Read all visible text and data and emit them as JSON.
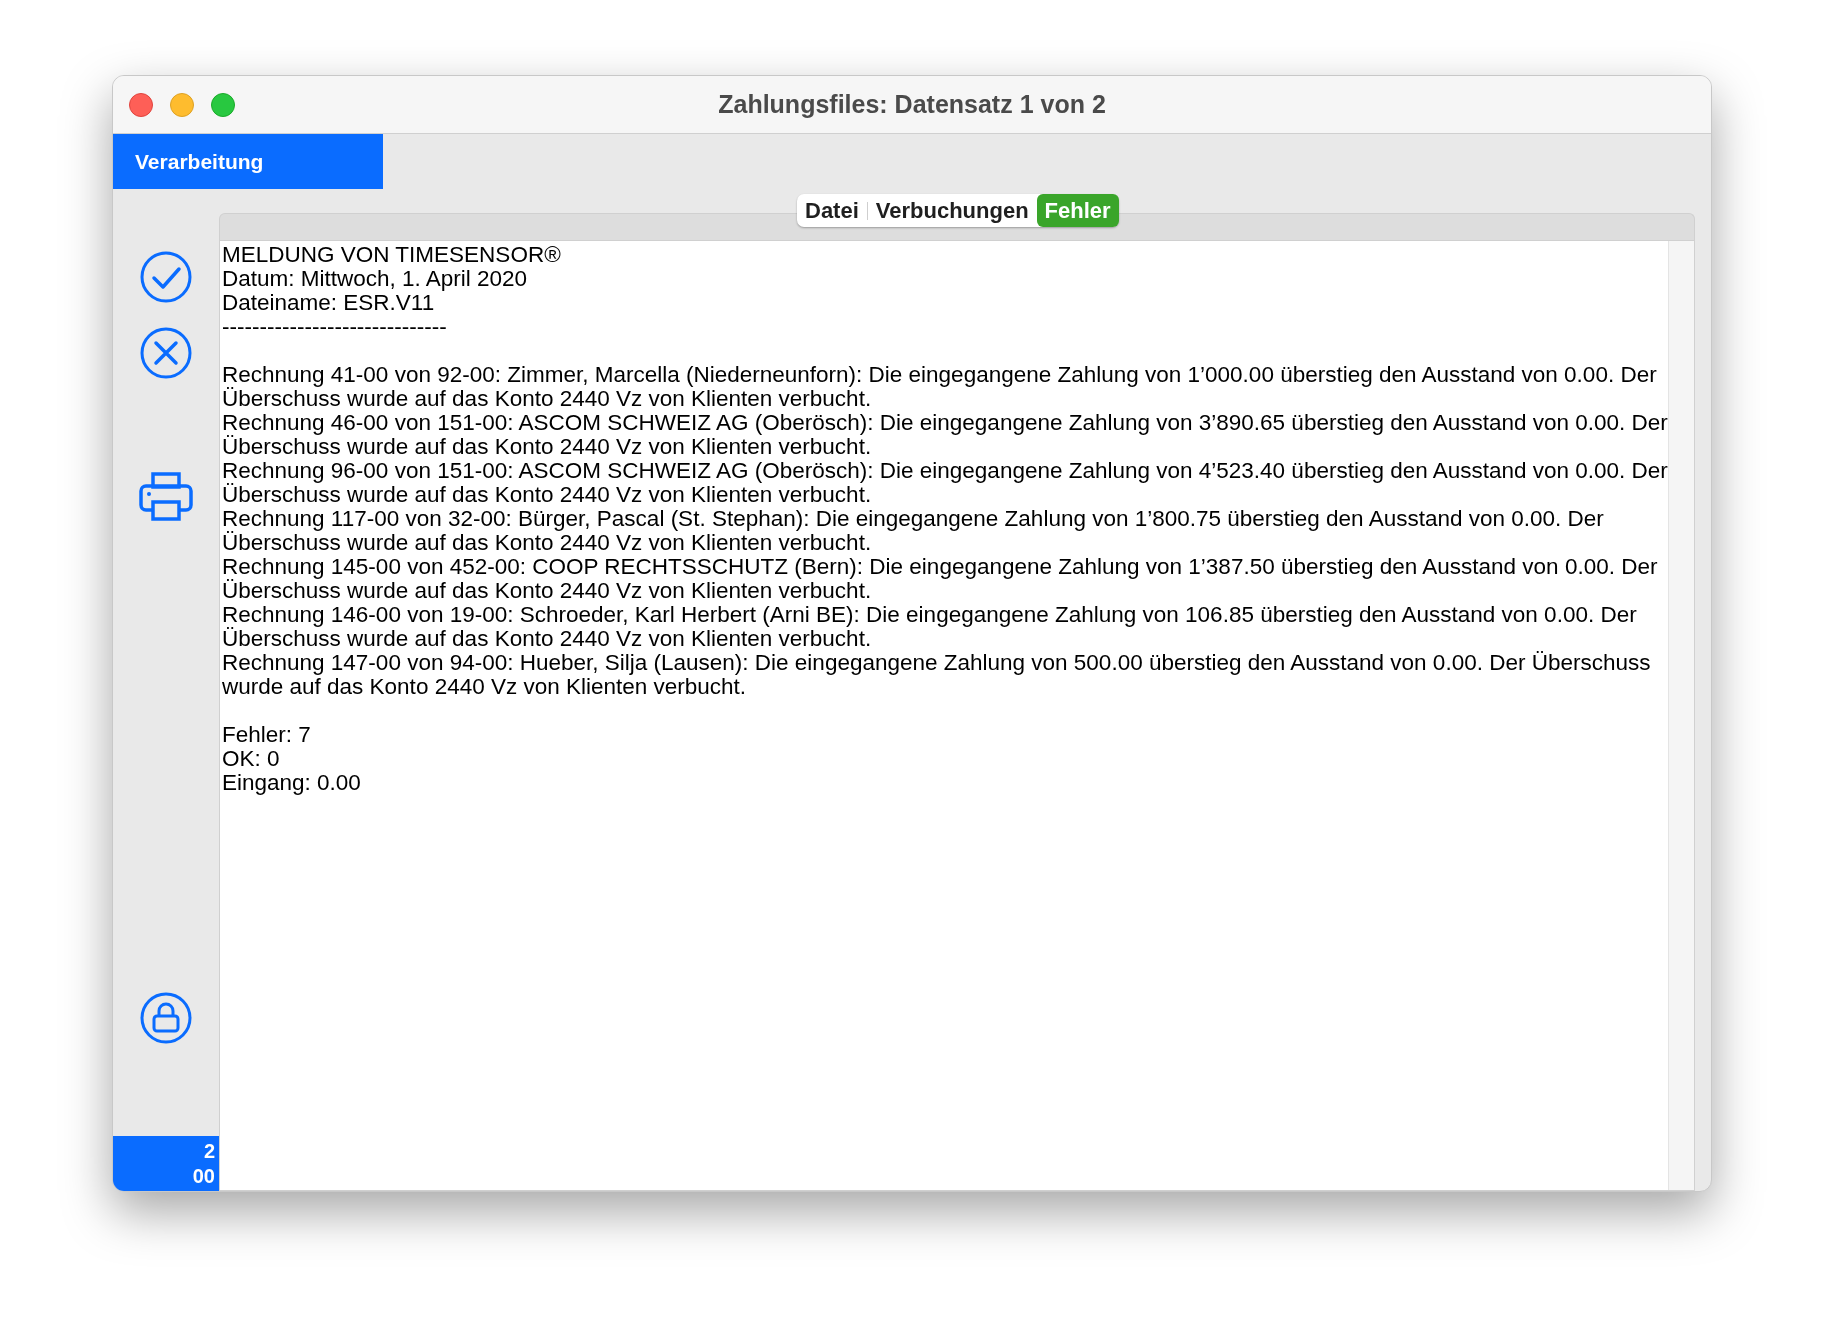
{
  "window": {
    "title": "Zahlungsfiles: Datensatz 1 von 2"
  },
  "section": {
    "label": "Verarbeitung"
  },
  "tabs": [
    {
      "label": "Datei",
      "selected": false
    },
    {
      "label": "Verbuchungen",
      "selected": false
    },
    {
      "label": "Fehler",
      "selected": true
    }
  ],
  "report": {
    "header": [
      "MELDUNG VON TIMESENSOR®",
      "Datum: Mittwoch, 1. April 2020",
      "Dateiname: ESR.V11",
      "------------------------------"
    ],
    "messages": [
      "Rechnung 41-00 von 92-00: Zimmer, Marcella (Niederneunforn): Die eingegangene Zahlung von 1’000.00 überstieg den Ausstand von 0.00. Der Überschuss wurde auf das Konto 2440 Vz von Klienten verbucht.",
      "Rechnung 46-00 von 151-00: ASCOM SCHWEIZ AG (Oberösch): Die eingegangene Zahlung von 3’890.65 überstieg den Ausstand von 0.00. Der Überschuss wurde auf das Konto 2440 Vz von Klienten verbucht.",
      "Rechnung 96-00 von 151-00: ASCOM SCHWEIZ AG (Oberösch): Die eingegangene Zahlung von 4’523.40 überstieg den Ausstand von 0.00. Der Überschuss wurde auf das Konto 2440 Vz von Klienten verbucht.",
      "Rechnung 117-00 von 32-00: Bürger, Pascal (St. Stephan): Die eingegangene Zahlung von 1’800.75 überstieg den Ausstand von 0.00. Der Überschuss wurde auf das Konto 2440 Vz von Klienten verbucht.",
      "Rechnung 145-00 von 452-00: COOP RECHTSSCHUTZ (Bern): Die eingegangene Zahlung von 1’387.50 überstieg den Ausstand von 0.00. Der Überschuss wurde auf das Konto 2440 Vz von Klienten verbucht.",
      "Rechnung 146-00 von 19-00: Schroeder, Karl Herbert (Arni BE): Die eingegangene Zahlung von 106.85 überstieg den Ausstand von 0.00. Der Überschuss wurde auf das Konto 2440 Vz von Klienten verbucht.",
      "Rechnung 147-00 von 94-00: Hueber, Silja (Lausen): Die eingegangene Zahlung von 500.00 überstieg den Ausstand von 0.00. Der Überschuss wurde auf das Konto 2440 Vz von Klienten verbucht."
    ],
    "summary": [
      "Fehler: 7",
      "OK: 0",
      "Eingang: 0.00"
    ]
  },
  "record_counter": [
    "2",
    "00"
  ]
}
